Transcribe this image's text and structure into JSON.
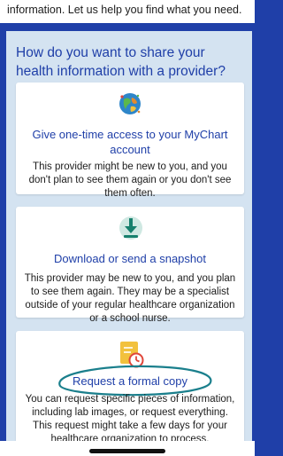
{
  "top_banner": {
    "text": "information. Let us help you find what you need."
  },
  "heading": "How do you want to share your health information with a provider?",
  "cards": [
    {
      "icon": "globe-icon",
      "title_line1": "Give one-time access to your MyChart",
      "title_line2": "account",
      "desc": [
        "This provider might be new to you, and you",
        "don't plan to see them again or you don't see",
        "them often."
      ]
    },
    {
      "icon": "download-icon",
      "title_line1": "Download or send a snapshot",
      "desc": [
        "This provider may be new to you, and you plan",
        "to see them again. They may be a specialist",
        "outside of your regular healthcare organization",
        "or a school nurse."
      ]
    },
    {
      "icon": "document-clock-icon",
      "title_line1": "Request a formal copy",
      "desc": [
        "You can request specific pieces of information,",
        "including lab images, or request everything.",
        "This request might take a few days for your",
        "healthcare organization to process."
      ]
    }
  ],
  "colors": {
    "brand_blue": "#1f3fa8",
    "panel_bg": "#d4e3f1",
    "annotation_teal": "#1a7f8c",
    "download_teal": "#17806d",
    "doc_yellow": "#f2c13d",
    "clock_red": "#e0463a"
  }
}
